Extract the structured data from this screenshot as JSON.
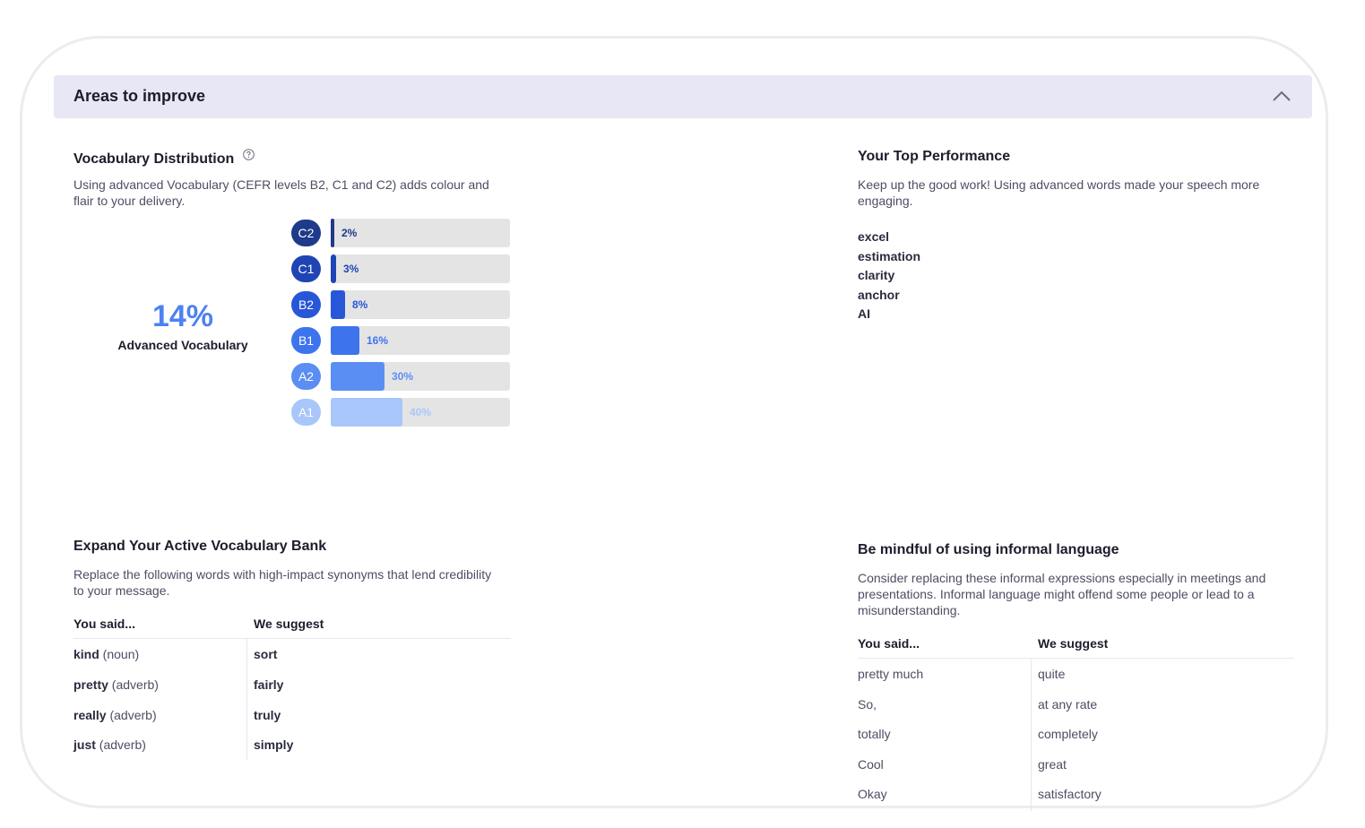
{
  "header": {
    "title": "Areas to improve",
    "collapse_icon": "chevron-up-icon"
  },
  "vocab_distribution": {
    "title": "Vocabulary Distribution",
    "help_icon": "question-circle-icon",
    "description": "Using advanced Vocabulary (CEFR levels B2, C1 and C2) adds colour and flair to your delivery.",
    "advanced_percent": "14%",
    "advanced_label": "Advanced Vocabulary",
    "levels": [
      {
        "level": "C2",
        "percent_label": "2%",
        "value": 2,
        "color": "#1e3a8a",
        "text_color": "#1e3a8a"
      },
      {
        "level": "C1",
        "percent_label": "3%",
        "value": 3,
        "color": "#1f45b5",
        "text_color": "#1f45b5"
      },
      {
        "level": "B2",
        "percent_label": "8%",
        "value": 8,
        "color": "#2756d9",
        "text_color": "#2756d9"
      },
      {
        "level": "B1",
        "percent_label": "16%",
        "value": 16,
        "color": "#3d74ee",
        "text_color": "#3d74ee"
      },
      {
        "level": "A2",
        "percent_label": "30%",
        "value": 30,
        "color": "#5b8ef2",
        "text_color": "#5b8ef2"
      },
      {
        "level": "A1",
        "percent_label": "40%",
        "value": 40,
        "color": "#a8c6f9",
        "text_color": "#a8c6f9"
      }
    ]
  },
  "top_performance": {
    "title": "Your Top Performance",
    "description": "Keep up the good work! Using advanced words made your speech more engaging.",
    "words": [
      "excel",
      "estimation",
      "clarity",
      "anchor",
      "AI"
    ]
  },
  "expand_vocab": {
    "title": "Expand Your Active Vocabulary Bank",
    "description": "Replace the following words with high-impact synonyms that lend credibility to your message.",
    "col_said": "You said...",
    "col_suggest": "We suggest",
    "rows": [
      {
        "word": "kind",
        "pos": "(noun)",
        "suggest": "sort"
      },
      {
        "word": "pretty",
        "pos": "(adverb)",
        "suggest": "fairly"
      },
      {
        "word": "really",
        "pos": "(adverb)",
        "suggest": "truly"
      },
      {
        "word": "just",
        "pos": "(adverb)",
        "suggest": "simply"
      }
    ]
  },
  "informal_language": {
    "title": "Be mindful of using informal language",
    "description": "Consider replacing these informal expressions especially in meetings and presentations. Informal language might offend some people or lead to a misunderstanding.",
    "col_said": "You said...",
    "col_suggest": "We suggest",
    "rows": [
      {
        "said": "pretty much",
        "suggest": "quite"
      },
      {
        "said": "So,",
        "suggest": "at any rate"
      },
      {
        "said": "totally",
        "suggest": "completely"
      },
      {
        "said": "Cool",
        "suggest": "great"
      },
      {
        "said": "Okay",
        "suggest": "satisfactory"
      }
    ]
  }
}
